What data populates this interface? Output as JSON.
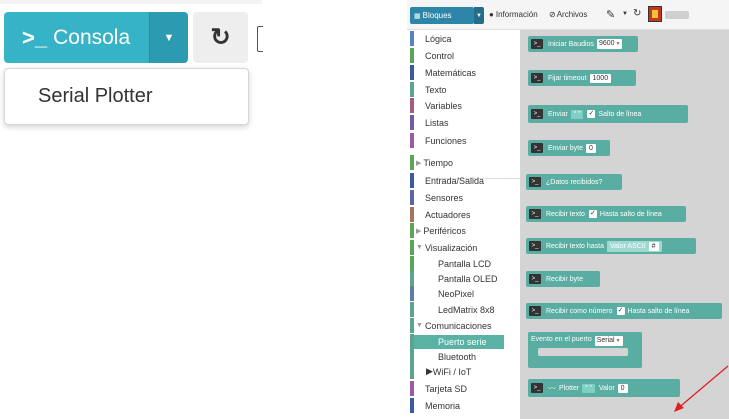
{
  "left_panel": {
    "console_button": {
      "prompt_icon": ">_",
      "label": "Consola"
    },
    "refresh_icon": "↻",
    "dropdown_menu": {
      "items": [
        "Serial Plotter"
      ]
    }
  },
  "toolbar": {
    "tabs": [
      {
        "label": "Bloques",
        "icon": "blocks-icon"
      },
      {
        "label": "Información",
        "icon": "info-icon"
      },
      {
        "label": "Archivos",
        "icon": "paperclip-icon"
      }
    ]
  },
  "categories": [
    {
      "label": "Lógica",
      "color": "#5a80c6"
    },
    {
      "label": "Control",
      "color": "#5ba55b"
    },
    {
      "label": "Matemáticas",
      "color": "#3a5ba0"
    },
    {
      "label": "Texto",
      "color": "#5ba58c"
    },
    {
      "label": "Variables",
      "color": "#a55b80"
    },
    {
      "label": "Listas",
      "color": "#745ba5"
    },
    {
      "label": "Funciones",
      "color": "#995ba5"
    },
    {
      "label": "Tiempo",
      "color": "#5ba55b"
    },
    {
      "label": "Entrada/Salida",
      "color": "#3a5ba0"
    },
    {
      "label": "Sensores",
      "color": "#5b67a5"
    },
    {
      "label": "Actuadores",
      "color": "#a5745b"
    },
    {
      "label": "Periféricos",
      "color": "#5ba55b"
    },
    {
      "label": "Visualización",
      "color": "#5ba55b"
    },
    {
      "label": "Pantalla LCD",
      "color": "#5ba55b"
    },
    {
      "label": "Pantalla OLED",
      "color": "#5ba58c"
    },
    {
      "label": "NeoPixel",
      "color": "#5b80a5"
    },
    {
      "label": "LedMatrix 8x8",
      "color": "#5ba58c"
    },
    {
      "label": "Comunicaciones",
      "color": "#5ba58c"
    },
    {
      "label": "Puerto serie",
      "color": "#5ba58c"
    },
    {
      "label": "Bluetooth",
      "color": "#5ba58c"
    },
    {
      "label": "WiFi / IoT",
      "color": "#5ba58c"
    },
    {
      "label": "Tarjeta SD",
      "color": "#995ba5"
    },
    {
      "label": "Memoria",
      "color": "#3a5ba0"
    }
  ],
  "blocks": {
    "iniciar": {
      "label": "Iniciar",
      "field": "Baudios",
      "value": "9600"
    },
    "fijar_timeout": {
      "label": "Fijar timeout",
      "value": "1000"
    },
    "enviar": {
      "label": "Enviar",
      "suffix": "Salto de línea"
    },
    "enviar_byte": {
      "label": "Enviar byte",
      "value": "0"
    },
    "datos_recibidos": {
      "label": "¿Datos recibidos?"
    },
    "recibir_texto": {
      "label": "Recibir texto",
      "suffix": "Hasta salto de línea"
    },
    "recibir_texto_hasta": {
      "label": "Recibir texto hasta",
      "field": "Valor ASCII",
      "value": "#"
    },
    "recibir_byte": {
      "label": "Recibir byte"
    },
    "recibir_numero": {
      "label": "Recibir como número",
      "suffix": "Hasta salto de línea"
    },
    "evento": {
      "label": "Evento en el puerto",
      "value": "Serial"
    },
    "plotter": {
      "label": "Plotter",
      "field": "Valor",
      "value": "0"
    }
  },
  "quote_text": "“ ”"
}
